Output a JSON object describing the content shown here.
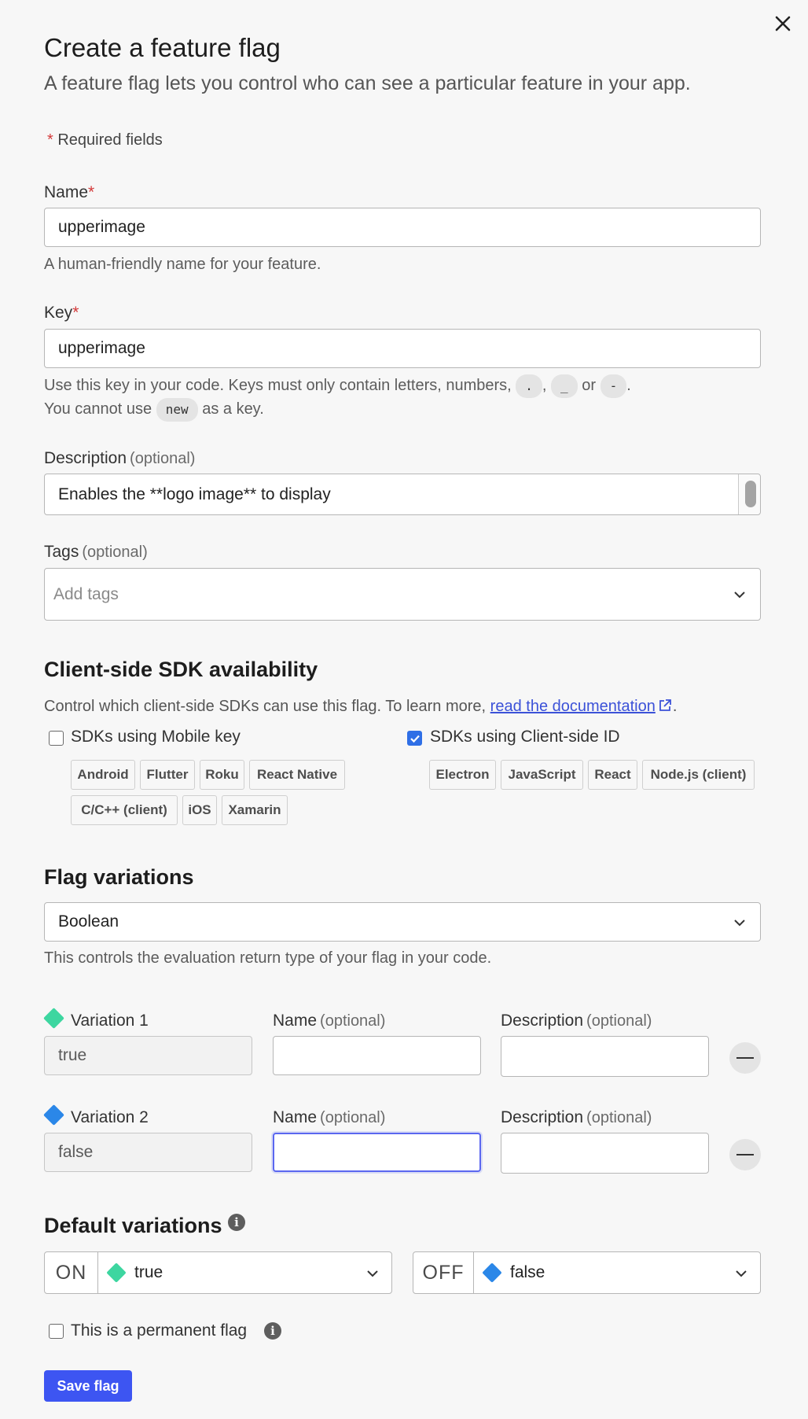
{
  "header": {
    "title": "Create a feature flag",
    "subtitle": "A feature flag lets you control who can see a particular feature in your app.",
    "required_star": "*",
    "required_text": "Required fields"
  },
  "name_field": {
    "label": "Name",
    "star": "*",
    "value": "upperimage",
    "help": "A human-friendly name for your feature."
  },
  "key_field": {
    "label": "Key",
    "star": "*",
    "value": "upperimage",
    "help_start": "Use this key in your code. Keys must only contain letters, numbers,",
    "chip_dot": ".",
    "comma": ",",
    "chip_underscore": "_",
    "or_text": "or",
    "chip_dash": "-",
    "period": ".",
    "help2_start": "You cannot use",
    "chip_new": "new",
    "help2_end": "as a key."
  },
  "description_field": {
    "label": "Description",
    "optional": "(optional)",
    "value": "Enables the **logo image** to display"
  },
  "tags_field": {
    "label": "Tags",
    "optional": "(optional)",
    "placeholder": "Add tags"
  },
  "sdk": {
    "title": "Client-side SDK availability",
    "help": "Control which client-side SDKs can use this flag. To learn more,",
    "link": "read the documentation",
    "period": ".",
    "mobile_label": "SDKs using Mobile key",
    "mobile_checked": false,
    "mobile_chips": [
      "Android",
      "Flutter",
      "Roku",
      "React Native",
      "C/C++ (client)",
      "iOS",
      "Xamarin"
    ],
    "client_label": "SDKs using Client-side ID",
    "client_checked": true,
    "client_chips": [
      "Electron",
      "JavaScript",
      "React",
      "Node.js (client)"
    ]
  },
  "variations": {
    "title": "Flag variations",
    "type_value": "Boolean",
    "help": "This controls the evaluation return type of your flag in your code.",
    "items": [
      {
        "label": "Variation 1",
        "value": "true",
        "name_label": "Name",
        "name_optional": "(optional)",
        "desc_label": "Description",
        "desc_optional": "(optional)",
        "color": "#3dd6a0"
      },
      {
        "label": "Variation 2",
        "value": "false",
        "name_label": "Name",
        "name_optional": "(optional)",
        "desc_label": "Description",
        "desc_optional": "(optional)",
        "color": "#2b87e8"
      }
    ]
  },
  "defaults": {
    "title": "Default variations",
    "on_label": "ON",
    "on_value": "true",
    "off_label": "OFF",
    "off_value": "false"
  },
  "permanent": {
    "label": "This is a permanent flag",
    "checked": false
  },
  "save_label": "Save flag",
  "colors": {
    "accent": "#3d55f2",
    "link": "#3c52d8",
    "true_variation": "#3dd6a0",
    "false_variation": "#2b87e8"
  }
}
